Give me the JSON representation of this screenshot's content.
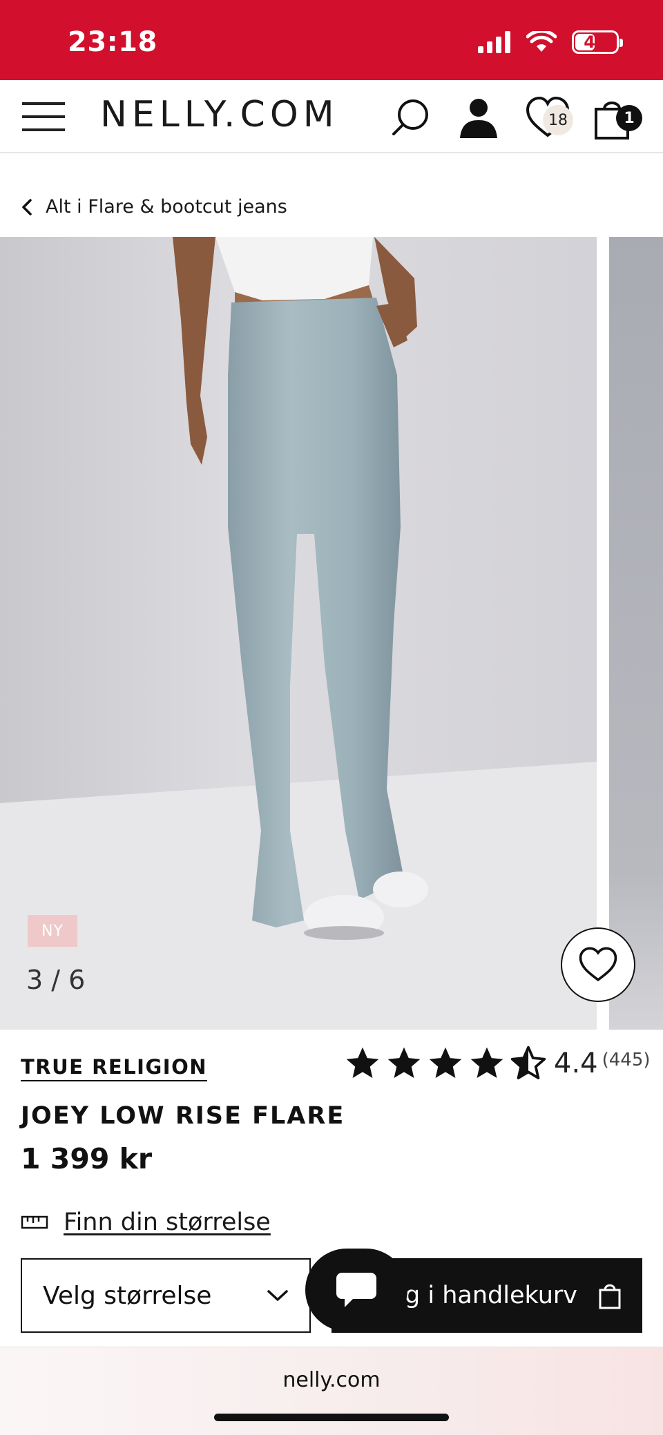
{
  "status_bar": {
    "time": "23:18",
    "battery_level": "47",
    "background_color": "#d20f2c"
  },
  "header": {
    "logo": "NELLY.COM",
    "wishlist_count": "18",
    "cart_count": "1",
    "icons": [
      "menu-icon",
      "search-icon",
      "user-icon",
      "heart-icon",
      "bag-icon"
    ]
  },
  "breadcrumb": {
    "label": "Alt i Flare & bootcut jeans"
  },
  "gallery": {
    "badge": "NY",
    "counter": "3 / 6"
  },
  "product": {
    "brand": "TRUE RELIGION",
    "name": "JOEY LOW RISE FLARE",
    "price": "1 399 kr",
    "rating": "4.4",
    "rating_count": "(445)",
    "stars_filled": 4.5
  },
  "actions": {
    "size_guide": "Finn din størrelse",
    "size_select": "Velg størrelse",
    "add_to_cart": "Legg i handlekurv"
  },
  "browser": {
    "url": "nelly.com"
  }
}
